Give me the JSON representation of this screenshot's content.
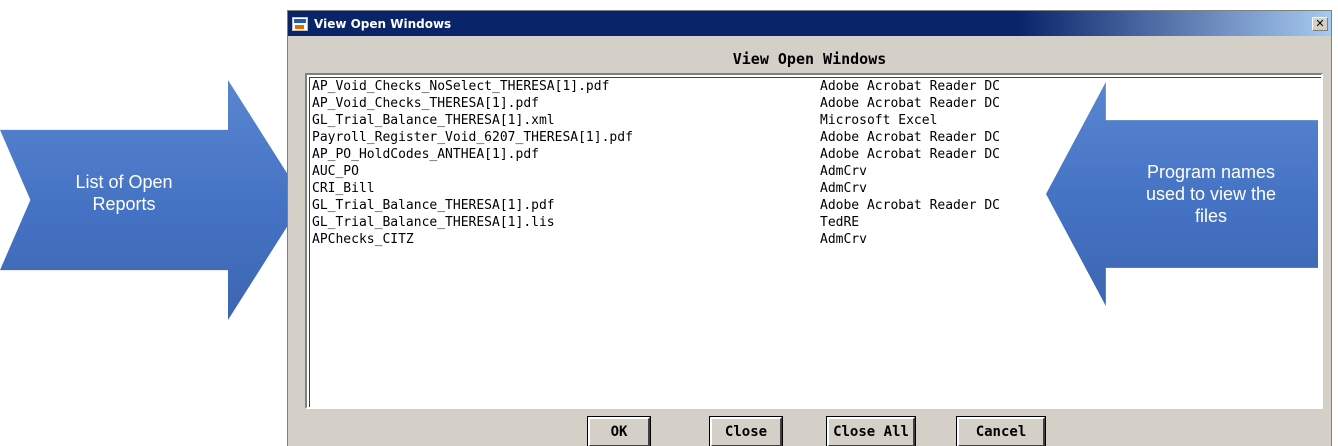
{
  "window": {
    "title": "View Open Windows",
    "close_glyph": "✕"
  },
  "dialog": {
    "heading": "View Open Windows"
  },
  "list": {
    "rows": [
      {
        "file": "AP_Void_Checks_NoSelect_THERESA[1].pdf",
        "program": "Adobe Acrobat Reader DC"
      },
      {
        "file": "AP_Void_Checks_THERESA[1].pdf",
        "program": "Adobe Acrobat Reader DC"
      },
      {
        "file": "GL_Trial_Balance_THERESA[1].xml",
        "program": "Microsoft Excel"
      },
      {
        "file": "Payroll_Register_Void_6207_THERESA[1].pdf",
        "program": "Adobe Acrobat Reader DC"
      },
      {
        "file": "AP_PO_HoldCodes_ANTHEA[1].pdf",
        "program": "Adobe Acrobat Reader DC"
      },
      {
        "file": "AUC_PO",
        "program": "AdmCrv"
      },
      {
        "file": "CRI_Bill",
        "program": "AdmCrv"
      },
      {
        "file": "GL_Trial_Balance_THERESA[1].pdf",
        "program": "Adobe Acrobat Reader DC"
      },
      {
        "file": "GL_Trial_Balance_THERESA[1].lis",
        "program": "TedRE"
      },
      {
        "file": "APChecks_CITZ",
        "program": "AdmCrv"
      }
    ]
  },
  "buttons": {
    "ok": "OK",
    "close": "Close",
    "close_all": "Close All",
    "cancel": "Cancel"
  },
  "callouts": {
    "left_line1": "List of Open",
    "left_line2": "Reports",
    "right_line1": "Program names",
    "right_line2": "used to view the",
    "right_line3": "files"
  },
  "colors": {
    "callout_fill": "#4472c4",
    "titlebar": "#0a246a",
    "dialog_face": "#d4d0c8"
  }
}
